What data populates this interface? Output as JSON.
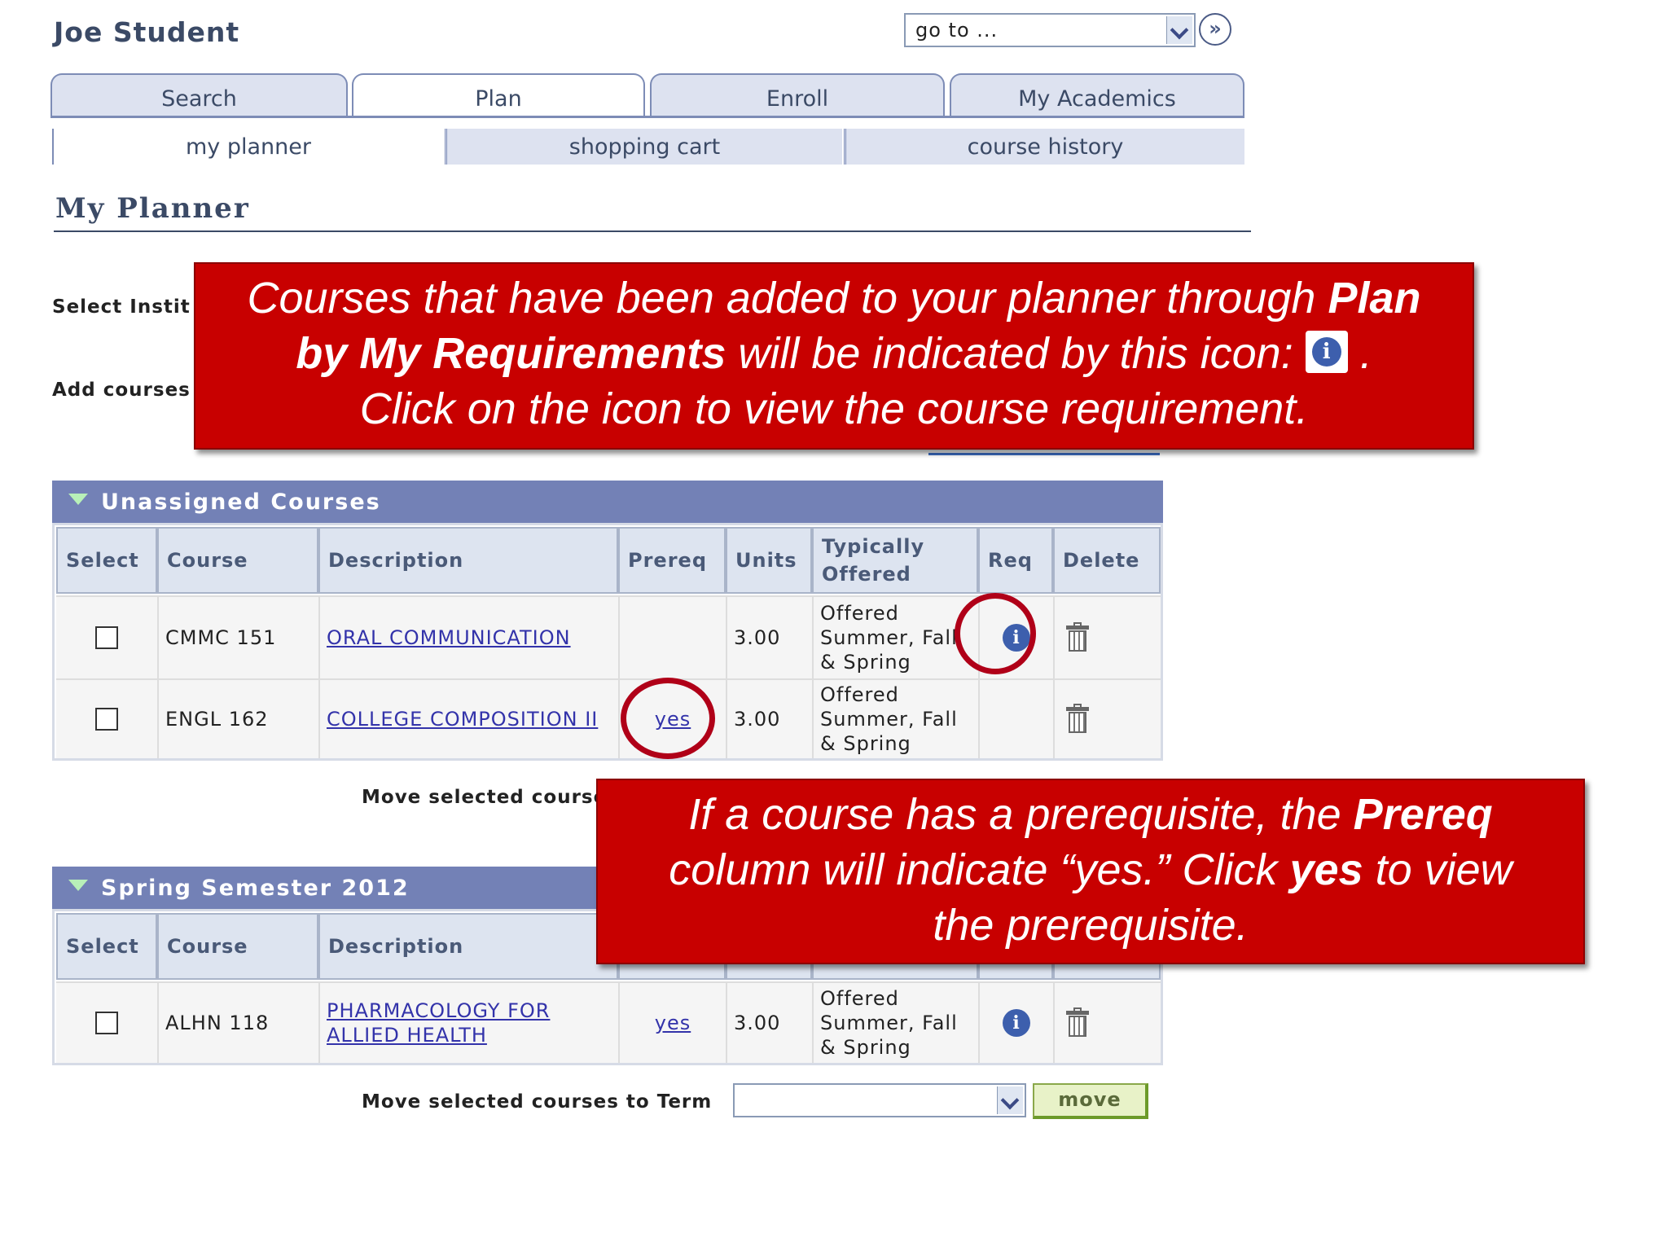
{
  "header": {
    "student_name": "Joe Student",
    "goto_value": "go to ...",
    "goto_button": "»"
  },
  "tabs": [
    {
      "label": "Search",
      "active": false
    },
    {
      "label": "Plan",
      "active": true
    },
    {
      "label": "Enroll",
      "active": false
    },
    {
      "label": "My Academics",
      "active": false
    }
  ],
  "subtabs": [
    {
      "label": "my planner",
      "active": true
    },
    {
      "label": "shopping cart",
      "active": false
    },
    {
      "label": "course history",
      "active": false
    }
  ],
  "page_title": "My Planner",
  "form": {
    "select_institution_label": "Select Instit",
    "add_courses_label": "Add courses"
  },
  "callouts": {
    "top": {
      "line1_prefix": "Courses that have been added to your planner through ",
      "line1_bold": "Plan",
      "line2_bold": "by My Requirements",
      "line2_suffix": " will be indicated by this icon: ",
      "line2_end": ".",
      "line3": "Click on the icon to view the course requirement."
    },
    "bottom": {
      "line1_prefix": "If a course has a prerequisite, the ",
      "line1_bold": "Prereq",
      "line2_prefix": "column will indicate “yes.” Click ",
      "line2_bold": "yes",
      "line2_suffix": " to view",
      "line3": "the prerequisite."
    }
  },
  "columns": [
    "Select",
    "Course",
    "Description",
    "Prereq",
    "Units",
    "Typically Offered",
    "Req",
    "Delete"
  ],
  "sections": [
    {
      "title": "Unassigned Courses",
      "rows": [
        {
          "course": "CMMC 151",
          "description": "ORAL COMMUNICATION",
          "prereq": "",
          "units": "3.00",
          "offered": "Offered Summer, Fall & Spring",
          "req_icon": true
        },
        {
          "course": "ENGL 162",
          "description": "COLLEGE COMPOSITION II",
          "prereq": "yes",
          "units": "3.00",
          "offered": "Offered Summer, Fall & Spring",
          "req_icon": false
        }
      ],
      "move_label": "Move selected course"
    },
    {
      "title": "Spring Semester 2012",
      "rows": [
        {
          "course": "ALHN 118",
          "description": "PHARMACOLOGY FOR ALLIED HEALTH",
          "prereq": "yes",
          "units": "3.00",
          "offered": "Offered Summer, Fall & Spring",
          "req_icon": true
        }
      ],
      "move_label": "Move selected courses to Term",
      "move_button": "move"
    }
  ],
  "icons": {
    "info": "i",
    "req_icon_name": "info-icon",
    "delete_icon_name": "trash-icon"
  },
  "colors": {
    "callout_red": "#c80000",
    "section_header": "#7381b6",
    "highlight_ring": "#b00018",
    "link": "#3333aa"
  }
}
